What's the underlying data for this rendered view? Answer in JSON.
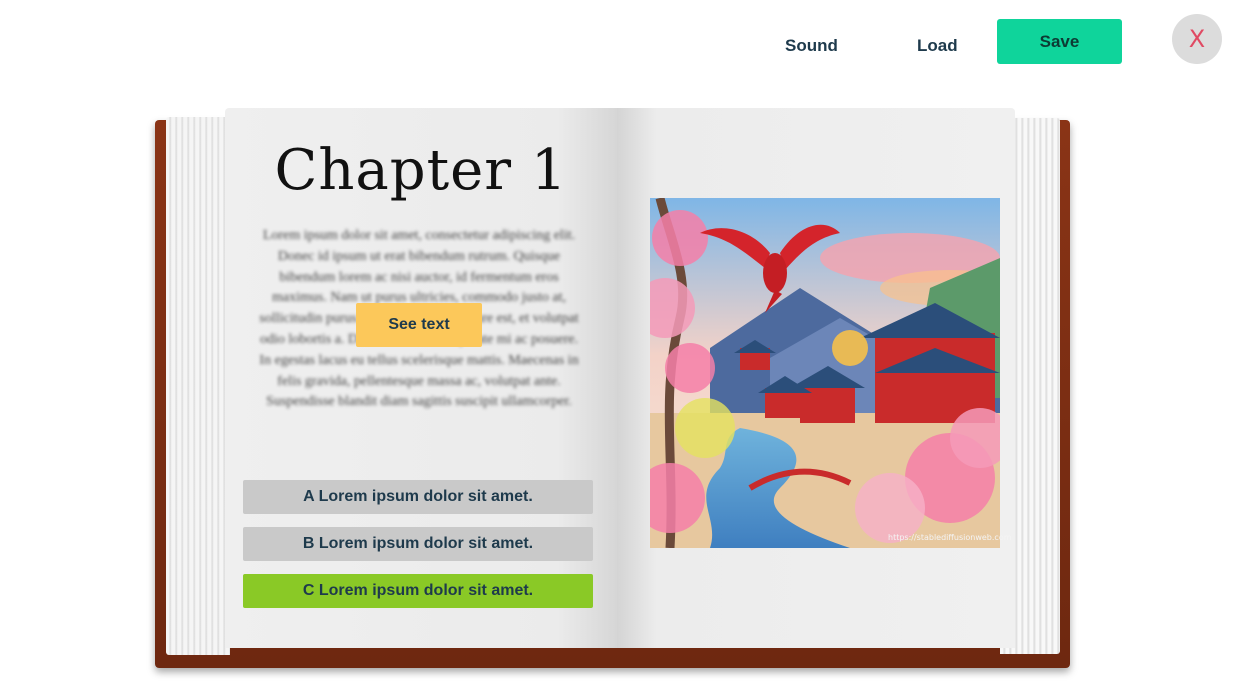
{
  "toolbar": {
    "sound_label": "Sound",
    "load_label": "Load",
    "save_label": "Save",
    "close_label": "X"
  },
  "book": {
    "chapter_title": "Chapter 1",
    "text": "Lorem ipsum dolor sit amet, consectetur adipiscing elit. Donec id ipsum ut erat bibendum rutrum. Quisque bibendum lorem ac nisi auctor, id fermentum eros maximus. Nam ut purus ultricies, commodo justo at, sollicitudin purus. Proin bibendum ornare est, et volutpat odio lobortis a. Donec tincidunt vulputate mi ac posuere. In egestas lacus eu tellus scelerisque mattis. Maecenas in felis gravida, pellentesque massa ac, volutpat ante. Suspendisse blandit diam sagittis suscipit ullamcorper.",
    "see_text_label": "See text",
    "options": [
      {
        "label": "A Lorem ipsum dolor sit amet."
      },
      {
        "label": "B Lorem ipsum dolor sit amet."
      },
      {
        "label": "C Lorem ipsum dolor sit amet."
      }
    ],
    "illustration_watermark": "https://stablediffusionweb.com"
  },
  "colors": {
    "save": "#0fd49b",
    "see_text": "#fcc85a",
    "option_default": "#c9c9c9",
    "option_selected": "#8ac926",
    "close_x": "#e04a63"
  }
}
